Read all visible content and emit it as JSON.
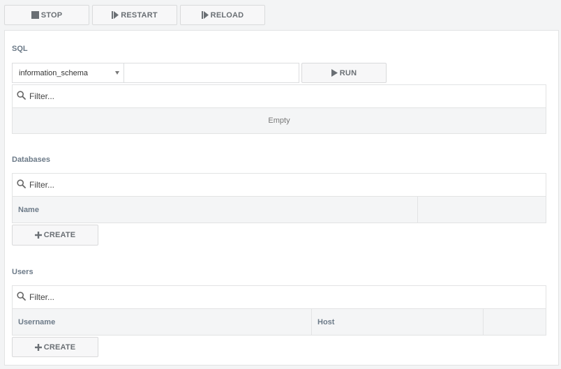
{
  "toolbar": {
    "stop_label": "STOP",
    "restart_label": "RESTART",
    "reload_label": "RELOAD"
  },
  "sql": {
    "title": "SQL",
    "database_selected": "information_schema",
    "query_value": "",
    "run_label": "RUN",
    "filter_placeholder": "Filter...",
    "empty_text": "Empty"
  },
  "databases": {
    "title": "Databases",
    "filter_placeholder": "Filter...",
    "columns": [
      "Name",
      ""
    ],
    "create_label": "CREATE"
  },
  "users": {
    "title": "Users",
    "filter_placeholder": "Filter...",
    "columns": [
      "Username",
      "Host",
      ""
    ],
    "create_label": "CREATE"
  },
  "colors": {
    "heading": "#6c7a88",
    "button_text": "#6a6f74",
    "border": "#e2e3e4",
    "header_bg": "#f4f5f6"
  }
}
